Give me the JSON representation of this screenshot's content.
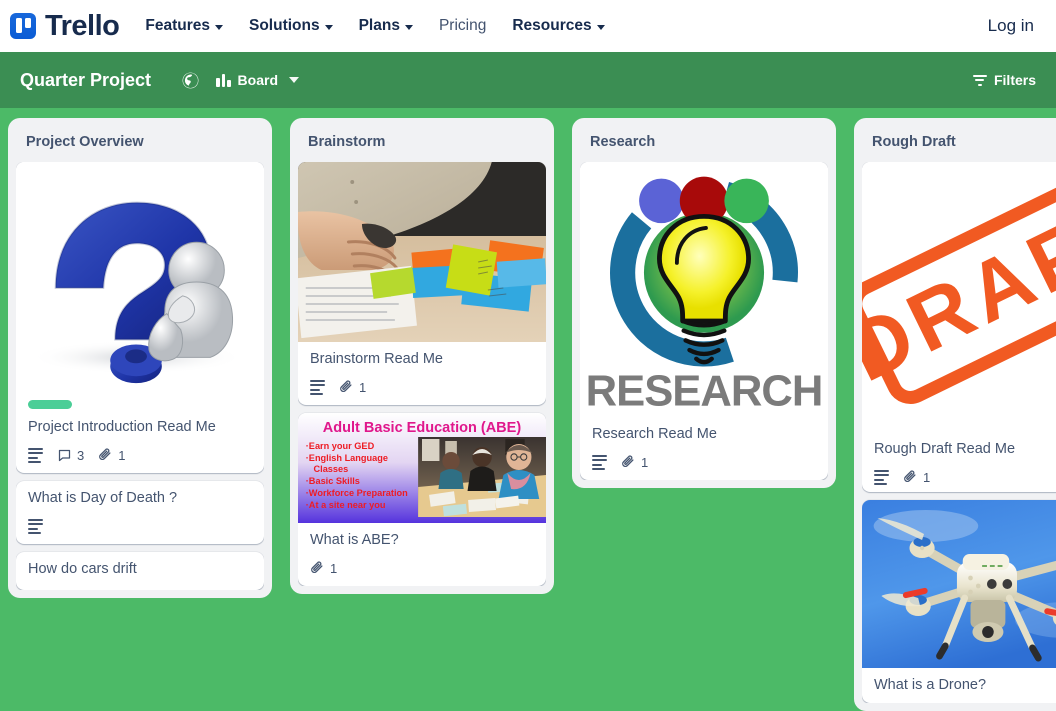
{
  "topnav": {
    "brand": "Trello",
    "links": [
      {
        "label": "Features",
        "has_caret": true
      },
      {
        "label": "Solutions",
        "has_caret": true
      },
      {
        "label": "Plans",
        "has_caret": true
      },
      {
        "label": "Pricing",
        "has_caret": false
      },
      {
        "label": "Resources",
        "has_caret": true
      }
    ],
    "login_label": "Log in"
  },
  "boardbar": {
    "title": "Quarter Project",
    "visibility_icon": "globe-icon",
    "view_icon": "board-columns-icon",
    "view_label": "Board",
    "filters_label": "Filters",
    "filter_icon": "filter-funnel-icon",
    "background_color": "#3b8e53"
  },
  "board": {
    "background_color": "#4cba67",
    "lists": [
      {
        "title": "Project Overview",
        "cards": [
          {
            "title": "Project Introduction Read Me",
            "cover": "question-mark-thinker-image",
            "label_color": "#4bce97",
            "has_description": true,
            "comments": "3",
            "attachments": "1"
          },
          {
            "title": "What is Day of Death ?",
            "cover": null,
            "has_description": true,
            "comments": null,
            "attachments": null
          },
          {
            "title": "How do cars drift",
            "cover": null,
            "has_description": false,
            "comments": null,
            "attachments": null
          }
        ]
      },
      {
        "title": "Brainstorm",
        "cards": [
          {
            "title": "Brainstorm Read Me",
            "cover": "hands-sticky-notes-photo",
            "has_description": true,
            "comments": null,
            "attachments": "1"
          },
          {
            "title": "What is ABE?",
            "cover": "adult-basic-education-poster",
            "has_description": false,
            "comments": null,
            "attachments": "1"
          }
        ]
      },
      {
        "title": "Research",
        "cards": [
          {
            "title": "Research Read Me",
            "cover": "research-lightbulb-logo",
            "has_description": true,
            "comments": null,
            "attachments": "1"
          }
        ]
      },
      {
        "title": "Rough Draft",
        "cards": [
          {
            "title": "Rough Draft Read Me",
            "cover": "draft-stamp-image",
            "has_description": true,
            "comments": null,
            "attachments": "1"
          },
          {
            "title": "What is a Drone?",
            "cover": "quadcopter-drone-photo",
            "has_description": false,
            "comments": null,
            "attachments": null
          }
        ]
      }
    ]
  },
  "cover_art": {
    "abe_poster": {
      "heading": "Adult Basic Education (ABE)",
      "bullets": [
        "·Earn your GED",
        "·English Language",
        "   Classes",
        "·Basic Skills",
        "·Workforce Preparation",
        "·At a site near you"
      ]
    },
    "research_logo": {
      "wordmark": "RESEARCH"
    },
    "draft_stamp": {
      "text": "DRAFT",
      "color": "#f15a22"
    }
  }
}
